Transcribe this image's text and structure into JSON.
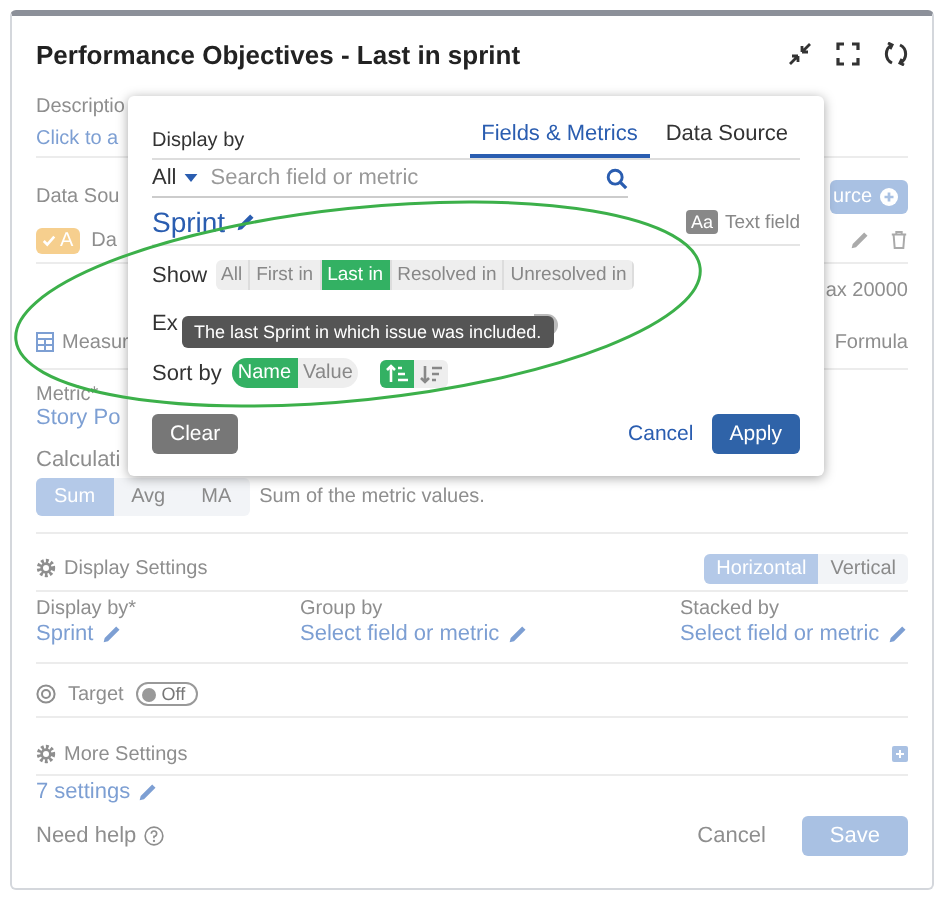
{
  "window": {
    "title": "Performance Objectives - Last in sprint"
  },
  "background": {
    "description_label": "Descriptio",
    "description_link": "Click to a",
    "data_source_label": "Data Sou",
    "add_source_button": "urce",
    "source_row": {
      "badge": "A",
      "name": "Da"
    },
    "max_text": "ax 20000",
    "measure_label": "Measur",
    "formula_label": "Formula",
    "metric_label": "Metric*",
    "metric_value": "Story Po",
    "calculation_label": "Calculati",
    "calc_options": [
      {
        "label": "Sum",
        "selected": true
      },
      {
        "label": "Avg",
        "selected": false
      },
      {
        "label": "MA",
        "selected": false
      }
    ],
    "calc_hint": "Sum of the metric values.",
    "display_settings": {
      "title": "Display Settings",
      "orientations": [
        {
          "label": "Horizontal",
          "selected": true
        },
        {
          "label": "Vertical",
          "selected": false
        }
      ],
      "fields": [
        {
          "label": "Display by*",
          "value": "Sprint"
        },
        {
          "label": "Group by",
          "value": "Select field or metric"
        },
        {
          "label": "Stacked by",
          "value": "Select field or metric"
        }
      ]
    },
    "target": {
      "label": "Target",
      "toggle": "Off",
      "on": false
    },
    "more_settings": {
      "title": "More Settings",
      "value": "7 settings"
    },
    "help": "Need help",
    "buttons": [
      {
        "label": "Cancel",
        "kind": "link"
      },
      {
        "label": "Save",
        "kind": "primary"
      }
    ]
  },
  "popup": {
    "display_by_label": "Display by",
    "tabs": [
      {
        "label": "Fields & Metrics",
        "selected": true
      },
      {
        "label": "Data Source",
        "selected": false
      }
    ],
    "filter": "All",
    "search": {
      "placeholder": "Search field or metric"
    },
    "field": {
      "name": "Sprint",
      "type_badge": "Aa",
      "type": "Text field"
    },
    "show_label": "Show",
    "show_options": [
      {
        "label": "All",
        "selected": false
      },
      {
        "label": "First in",
        "selected": false
      },
      {
        "label": "Last in",
        "selected": true
      },
      {
        "label": "Resolved in",
        "selected": false
      },
      {
        "label": "Unresolved in",
        "selected": false
      }
    ],
    "exclude_label": "Ex",
    "exclude_on": false,
    "tooltip": "The last Sprint in which issue was included.",
    "sort_label": "Sort by",
    "sort_options": [
      {
        "label": "Name",
        "selected": true
      },
      {
        "label": "Value",
        "selected": false
      }
    ],
    "sort_directions": [
      {
        "kind": "ascending",
        "selected": true
      },
      {
        "kind": "descending",
        "selected": false
      }
    ],
    "buttons": [
      {
        "label": "Clear",
        "kind": "secondary"
      },
      {
        "label": "Cancel",
        "kind": "link"
      },
      {
        "label": "Apply",
        "kind": "primary"
      }
    ]
  }
}
